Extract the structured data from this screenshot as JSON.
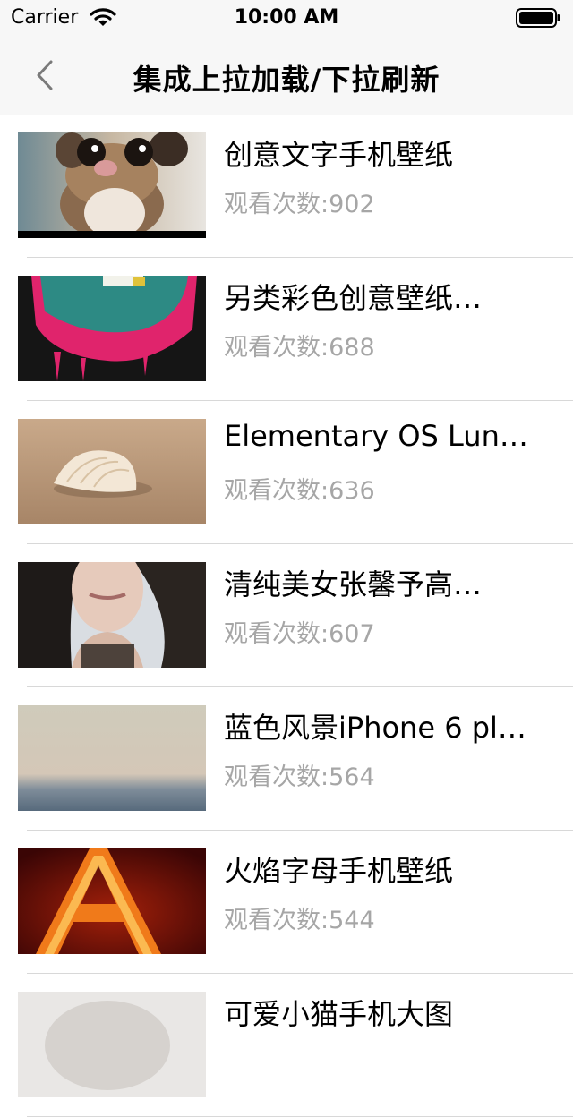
{
  "status_bar": {
    "carrier": "Carrier",
    "time": "10:00 AM"
  },
  "nav": {
    "title": "集成上拉加载/下拉刷新",
    "back_icon": "chevron-left-icon"
  },
  "items": [
    {
      "title": "创意文字手机壁纸",
      "views": "观看次数:902"
    },
    {
      "title": "另类彩色创意壁纸…",
      "views": "观看次数:688"
    },
    {
      "title": "Elementary OS Lun…",
      "views": "观看次数:636"
    },
    {
      "title": "清纯美女张馨予高…",
      "views": "观看次数:607"
    },
    {
      "title": "蓝色风景iPhone 6 pl…",
      "views": "观看次数:564"
    },
    {
      "title": "火焰字母手机壁纸",
      "views": "观看次数:544"
    },
    {
      "title": "可爱小猫手机大图",
      "views": ""
    }
  ],
  "colors": {
    "bar_background": "#f7f7f7",
    "separator": "#d8d8d8",
    "secondary_text": "#a6a6a6"
  }
}
